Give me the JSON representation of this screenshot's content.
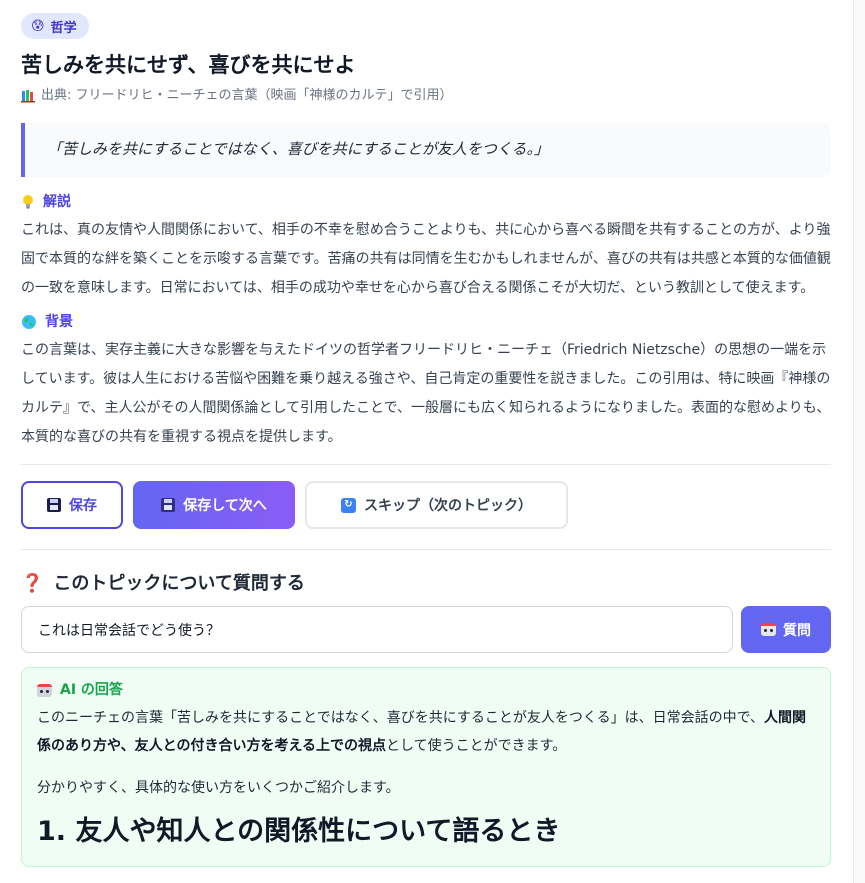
{
  "topic": {
    "category_emoji": "😰",
    "category": "哲学",
    "title": "苦しみを共にせず、喜びを共にせよ",
    "source_icon": "books-icon",
    "source": "出典: フリードリヒ・ニーチェの言葉（映画「神様のカルテ」で引用）",
    "quote": "「苦しみを共にすることではなく、喜びを共にすることが友人をつくる。」"
  },
  "explanation": {
    "icon": "lightbulb-icon",
    "heading": "解説",
    "body": "これは、真の友情や人間関係において、相手の不幸を慰め合うことよりも、共に心から喜べる瞬間を共有することの方が、より強固で本質的な絆を築くことを示唆する言葉です。苦痛の共有は同情を生むかもしれませんが、喜びの共有は共感と本質的な価値観の一致を意味します。日常においては、相手の成功や幸せを心から喜び合える関係こそが大切だ、という教訓として使えます。"
  },
  "background": {
    "icon": "globe-icon",
    "heading": "背景",
    "body": "この言葉は、実存主義に大きな影響を与えたドイツの哲学者フリードリヒ・ニーチェ（Friedrich Nietzsche）の思想の一端を示しています。彼は人生における苦悩や困難を乗り越える強さや、自己肯定の重要性を説きました。この引用は、特に映画『神様のカルテ』で、主人公がその人間関係論として引用したことで、一般層にも広く知られるようになりました。表面的な慰めよりも、本質的な喜びの共有を重視する視点を提供します。"
  },
  "actions": {
    "save_label": "保存",
    "save_next_label": "保存して次へ",
    "skip_label": "スキップ（次のトピック）"
  },
  "ask": {
    "heading": "このトピックについて質問する",
    "input_value": "これは日常会話でどう使う？",
    "button_label": "質問"
  },
  "ai_answer": {
    "heading": "AI の回答",
    "para1_before": "このニーチェの言葉「苦しみを共にすることではなく、喜びを共にすることが友人をつくる」は、日常会話の中で、",
    "para1_bold": "人間関係のあり方や、友人との付き合い方を考える上での視点",
    "para1_after": "として使うことができます。",
    "para2": "分かりやすく、具体的な使い方をいくつかご紹介します。",
    "section1_title": "1. 友人や知人との関係性について語るとき"
  },
  "colors": {
    "accent": "#6366f1",
    "accent_dark": "#4f46e5",
    "ai_green": "#16a34a",
    "ai_bg": "#f0fdf4"
  }
}
